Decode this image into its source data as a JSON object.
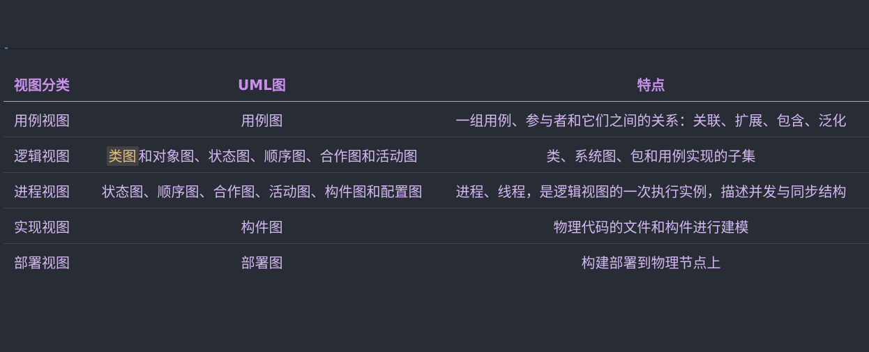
{
  "table": {
    "headers": [
      "视图分类",
      "UML图",
      "特点"
    ],
    "rows": [
      {
        "view": "用例视图",
        "diagrams": "用例图",
        "diagrams_highlight": "",
        "features": "一组用例、参与者和它们之间的关系：关联、扩展、包含、泛化"
      },
      {
        "view": "逻辑视图",
        "diagrams": "和对象图、状态图、顺序图、合作图和活动图",
        "diagrams_highlight": "类图",
        "features": "类、系统图、包和用例实现的子集"
      },
      {
        "view": "进程视图",
        "diagrams": "状态图、顺序图、合作图、活动图、构件图和配置图",
        "diagrams_highlight": "",
        "features": "进程、线程，是逻辑视图的一次执行实例，描述并发与同步结构"
      },
      {
        "view": "实现视图",
        "diagrams": "构件图",
        "diagrams_highlight": "",
        "features": "物理代码的文件和构件进行建模"
      },
      {
        "view": "部署视图",
        "diagrams": "部署图",
        "diagrams_highlight": "",
        "features": "构建部署到物理节点上"
      }
    ]
  }
}
